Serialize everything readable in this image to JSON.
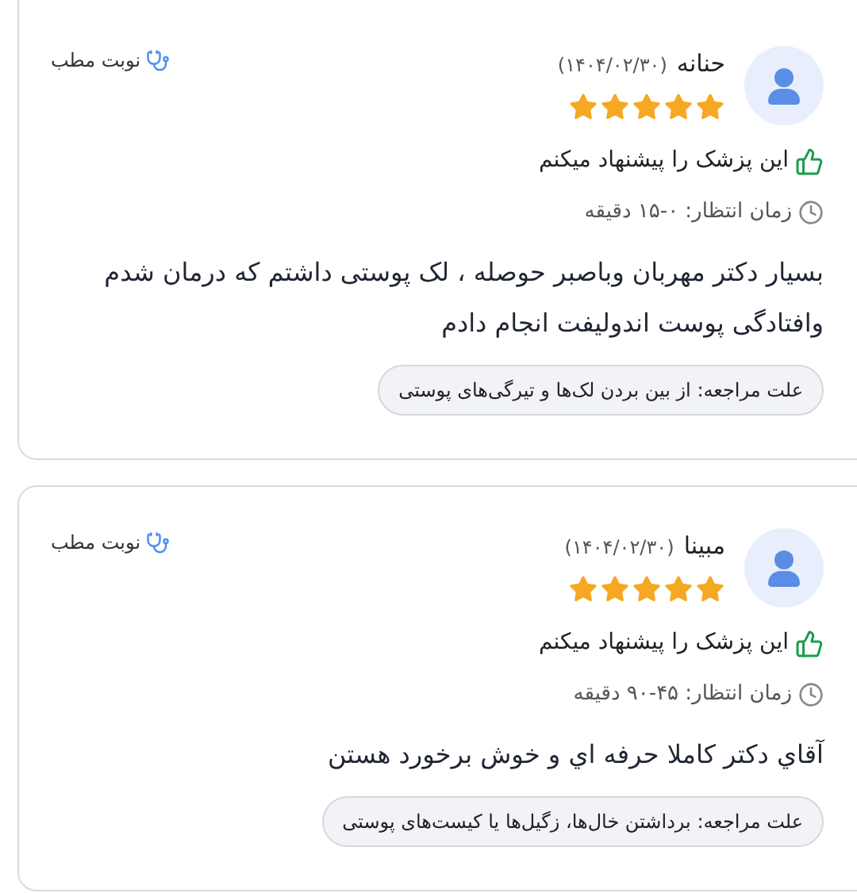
{
  "reviews": [
    {
      "name": "حنانه",
      "date": "(۱۴۰۴/۰۲/۳۰)",
      "stars": 5,
      "recommend": "این پزشک را پیشنهاد میکنم",
      "wait_time": "زمان انتظار: ۰-۱۵ دقیقه",
      "comment": "بسیار دکتر مهربان وباصبر حوصله ، لک پوستی داشتم که درمان شدم وافتادگی پوست اندولیفت انجام دادم",
      "reason": "علت مراجعه: از بین بردن لک‌ها و تیرگی‌های پوستی",
      "visit_type": "نوبت مطب"
    },
    {
      "name": "مبینا",
      "date": "(۱۴۰۴/۰۲/۳۰)",
      "stars": 5,
      "recommend": "این پزشک را پیشنهاد میکنم",
      "wait_time": "زمان انتظار: ۴۵-۹۰ دقیقه",
      "comment": "آقاي دکتر کاملا حرفه اي و خوش برخورد هستن",
      "reason": "علت مراجعه: برداشتن خال‌ها، زگیل‌ها یا کیست‌های پوستی",
      "visit_type": "نوبت مطب"
    }
  ]
}
